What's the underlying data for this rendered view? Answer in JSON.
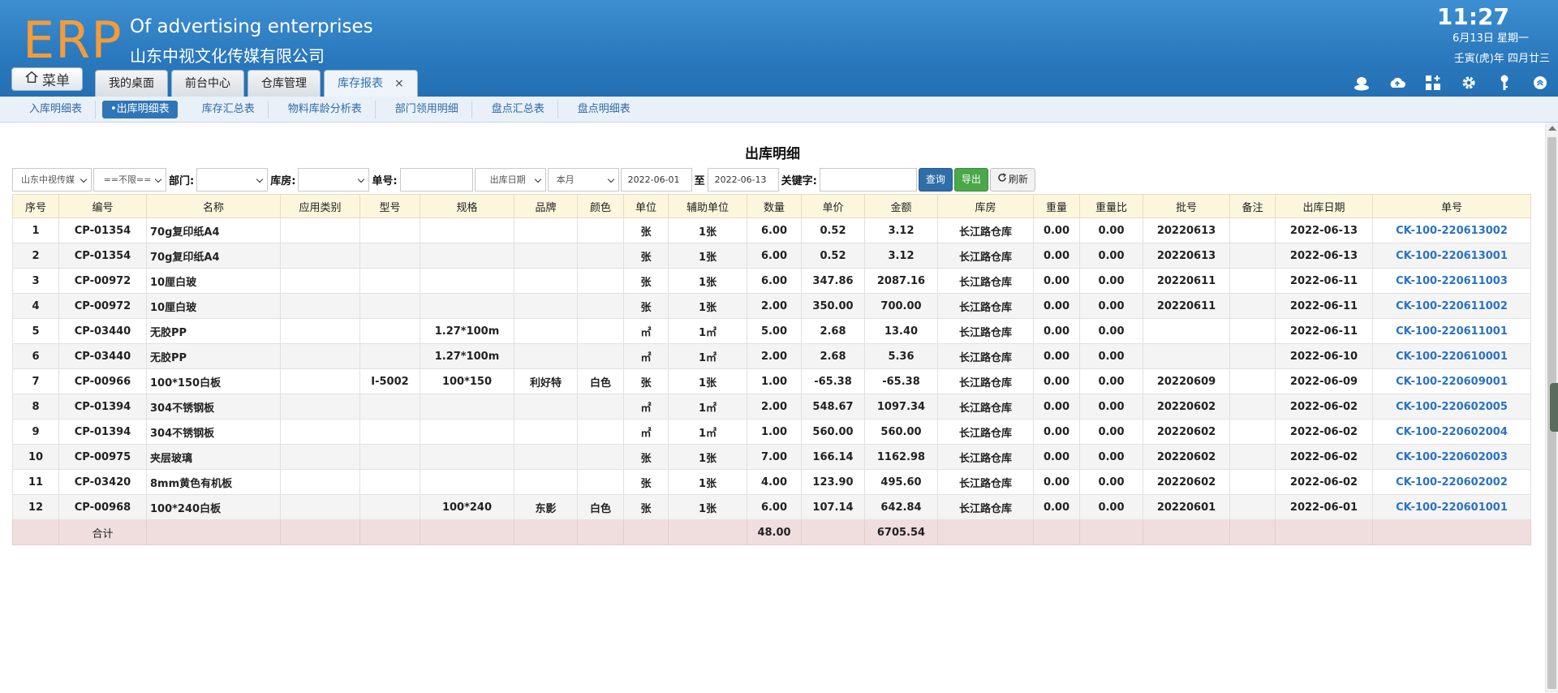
{
  "header": {
    "logo": "ERP",
    "company_en": "Of advertising enterprises",
    "company_cn": "山东中视文化传媒有限公司",
    "time": "11:27",
    "date": "6月13日 星期一",
    "lunar": "壬寅(虎)年 四月廿三",
    "menu_label": "菜单",
    "tabs": [
      {
        "label": "我的桌面"
      },
      {
        "label": "前台中心"
      },
      {
        "label": "仓库管理"
      },
      {
        "label": "库存报表",
        "active": true,
        "close": "×"
      }
    ],
    "icons": [
      "user-icon",
      "cloud-upload-icon",
      "apps-icon",
      "gear-icon",
      "key-icon",
      "collapse-icon"
    ]
  },
  "subnav": {
    "items": [
      "入库明细表",
      "•出库明细表",
      "库存汇总表",
      "物料库龄分析表",
      "部门领用明细",
      "盘点汇总表",
      "盘点明细表"
    ],
    "active_index": 1
  },
  "report": {
    "title": "出库明细"
  },
  "filters": {
    "company": "山东中视传媒",
    "scope": "==不限==",
    "dept_label": "部门:",
    "dept_value": "",
    "warehouse_label": "库房:",
    "warehouse_value": "",
    "order_label": "单号:",
    "order_value": "",
    "date_type": "出库日期",
    "period": "本月",
    "date_from": "2022-06-01",
    "to_label": "至",
    "date_to": "2022-06-13",
    "keyword_label": "关键字:",
    "keyword_value": "",
    "query_label": "查询",
    "export_label": "导出",
    "refresh_label": "刷新"
  },
  "table": {
    "columns": [
      "序号",
      "编号",
      "名称",
      "应用类别",
      "型号",
      "规格",
      "品牌",
      "颜色",
      "单位",
      "辅助单位",
      "数量",
      "单价",
      "金额",
      "库房",
      "重量",
      "重量比",
      "批号",
      "备注",
      "出库日期",
      "单号"
    ],
    "rows": [
      [
        "1",
        "CP-01354",
        "70g复印纸A4",
        "",
        "",
        "",
        "",
        "",
        "张",
        "1张",
        "6.00",
        "0.52",
        "3.12",
        "长江路仓库",
        "0.00",
        "0.00",
        "20220613",
        "",
        "2022-06-13",
        "CK-100-220613002"
      ],
      [
        "2",
        "CP-01354",
        "70g复印纸A4",
        "",
        "",
        "",
        "",
        "",
        "张",
        "1张",
        "6.00",
        "0.52",
        "3.12",
        "长江路仓库",
        "0.00",
        "0.00",
        "20220613",
        "",
        "2022-06-13",
        "CK-100-220613001"
      ],
      [
        "3",
        "CP-00972",
        "10厘白玻",
        "",
        "",
        "",
        "",
        "",
        "张",
        "1张",
        "6.00",
        "347.86",
        "2087.16",
        "长江路仓库",
        "0.00",
        "0.00",
        "20220611",
        "",
        "2022-06-11",
        "CK-100-220611003"
      ],
      [
        "4",
        "CP-00972",
        "10厘白玻",
        "",
        "",
        "",
        "",
        "",
        "张",
        "1张",
        "2.00",
        "350.00",
        "700.00",
        "长江路仓库",
        "0.00",
        "0.00",
        "20220611",
        "",
        "2022-06-11",
        "CK-100-220611002"
      ],
      [
        "5",
        "CP-03440",
        "无胶PP",
        "",
        "",
        "1.27*100m",
        "",
        "",
        "㎡",
        "1㎡",
        "5.00",
        "2.68",
        "13.40",
        "长江路仓库",
        "0.00",
        "0.00",
        "",
        "",
        "2022-06-11",
        "CK-100-220611001"
      ],
      [
        "6",
        "CP-03440",
        "无胶PP",
        "",
        "",
        "1.27*100m",
        "",
        "",
        "㎡",
        "1㎡",
        "2.00",
        "2.68",
        "5.36",
        "长江路仓库",
        "0.00",
        "0.00",
        "",
        "",
        "2022-06-10",
        "CK-100-220610001"
      ],
      [
        "7",
        "CP-00966",
        "100*150白板",
        "",
        "I-5002",
        "100*150",
        "利好特",
        "白色",
        "张",
        "1张",
        "1.00",
        "-65.38",
        "-65.38",
        "长江路仓库",
        "0.00",
        "0.00",
        "20220609",
        "",
        "2022-06-09",
        "CK-100-220609001"
      ],
      [
        "8",
        "CP-01394",
        "304不锈钢板",
        "",
        "",
        "",
        "",
        "",
        "㎡",
        "1㎡",
        "2.00",
        "548.67",
        "1097.34",
        "长江路仓库",
        "0.00",
        "0.00",
        "20220602",
        "",
        "2022-06-02",
        "CK-100-220602005"
      ],
      [
        "9",
        "CP-01394",
        "304不锈钢板",
        "",
        "",
        "",
        "",
        "",
        "㎡",
        "1㎡",
        "1.00",
        "560.00",
        "560.00",
        "长江路仓库",
        "0.00",
        "0.00",
        "20220602",
        "",
        "2022-06-02",
        "CK-100-220602004"
      ],
      [
        "10",
        "CP-00975",
        "夹层玻璃",
        "",
        "",
        "",
        "",
        "",
        "张",
        "1张",
        "7.00",
        "166.14",
        "1162.98",
        "长江路仓库",
        "0.00",
        "0.00",
        "20220602",
        "",
        "2022-06-02",
        "CK-100-220602003"
      ],
      [
        "11",
        "CP-03420",
        "8mm黄色有机板",
        "",
        "",
        "",
        "",
        "",
        "张",
        "1张",
        "4.00",
        "123.90",
        "495.60",
        "长江路仓库",
        "0.00",
        "0.00",
        "20220602",
        "",
        "2022-06-02",
        "CK-100-220602002"
      ],
      [
        "12",
        "CP-00968",
        "100*240白板",
        "",
        "",
        "100*240",
        "东影",
        "白色",
        "张",
        "1张",
        "6.00",
        "107.14",
        "642.84",
        "长江路仓库",
        "0.00",
        "0.00",
        "20220601",
        "",
        "2022-06-01",
        "CK-100-220601001"
      ]
    ],
    "total": {
      "label": "合计",
      "qty": "48.00",
      "amount": "6705.54"
    }
  },
  "colors": {
    "header_bg": "#2a78bd",
    "logo": "#f39c3a",
    "link": "#2a72c2",
    "table_header_bg": "#fcf6dd",
    "total_row_bg": "#f0dddd",
    "query_button": "#2f6ea8",
    "export_button": "#4aa84a"
  }
}
